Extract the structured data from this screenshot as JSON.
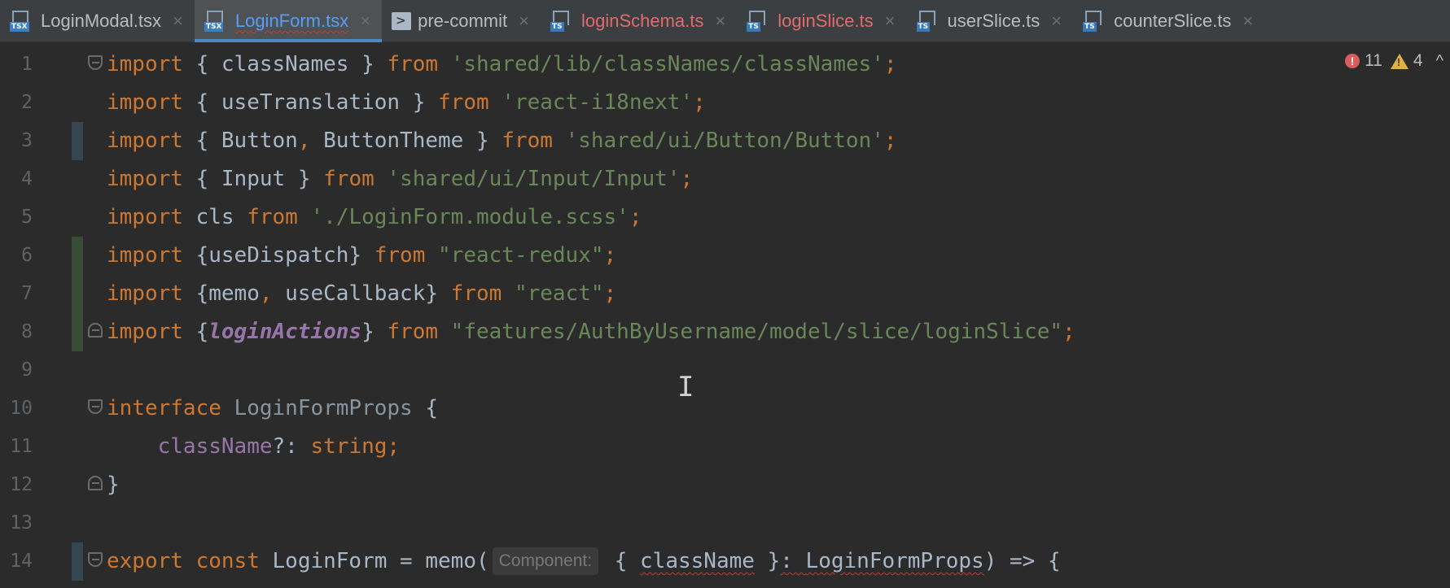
{
  "tabs": [
    {
      "label": "LoginModal.tsx",
      "icon": "tsx-file-icon",
      "badge": "TSX",
      "state": "normal"
    },
    {
      "label": "LoginForm.tsx",
      "icon": "tsx-file-icon",
      "badge": "TSX",
      "state": "active"
    },
    {
      "label": "pre-commit",
      "icon": "shell-script-icon",
      "badge": ">",
      "state": "normal"
    },
    {
      "label": "loginSchema.ts",
      "icon": "ts-file-icon",
      "badge": "TS",
      "state": "error"
    },
    {
      "label": "loginSlice.ts",
      "icon": "ts-file-icon",
      "badge": "TS",
      "state": "error"
    },
    {
      "label": "userSlice.ts",
      "icon": "ts-file-icon",
      "badge": "TS",
      "state": "normal"
    },
    {
      "label": "counterSlice.ts",
      "icon": "ts-file-icon",
      "badge": "TS",
      "state": "normal"
    }
  ],
  "tab_close_glyph": "×",
  "inspections": {
    "errors": "11",
    "warnings": "4",
    "error_glyph": "!",
    "warning_glyph": "!",
    "collapse_glyph": "^"
  },
  "line_numbers": [
    "1",
    "2",
    "3",
    "4",
    "5",
    "6",
    "7",
    "8",
    "9",
    "10",
    "11",
    "12",
    "13",
    "14"
  ],
  "code": {
    "l1": {
      "kw1": "import",
      "p1": " { ",
      "id1": "classNames",
      "p2": " } ",
      "kw2": "from",
      "sp": " ",
      "str": "'shared/lib/classNames/classNames'",
      "semi": ";"
    },
    "l2": {
      "kw1": "import",
      "p1": " { ",
      "id1": "useTranslation",
      "p2": " } ",
      "kw2": "from",
      "sp": " ",
      "str": "'react-i18next'",
      "semi": ";"
    },
    "l3": {
      "kw1": "import",
      "p1": " { ",
      "id1": "Button",
      "comma": ",",
      "sp0": " ",
      "id2": "ButtonTheme",
      "p2": " } ",
      "kw2": "from",
      "sp": " ",
      "str": "'shared/ui/Button/Button'",
      "semi": ";"
    },
    "l4": {
      "kw1": "import",
      "p1": " { ",
      "id1": "Input",
      "p2": " } ",
      "kw2": "from",
      "sp": " ",
      "str": "'shared/ui/Input/Input'",
      "semi": ";"
    },
    "l5": {
      "kw1": "import",
      "p1": " ",
      "id1": "cls",
      "p2": " ",
      "kw2": "from",
      "sp": " ",
      "str": "'./LoginForm.module.scss'",
      "semi": ";"
    },
    "l6": {
      "kw1": "import",
      "p1": " {",
      "id1": "useDispatch",
      "p2": "} ",
      "kw2": "from",
      "sp": " ",
      "str": "\"react-redux\"",
      "semi": ";"
    },
    "l7": {
      "kw1": "import",
      "p1": " {",
      "id1": "memo",
      "comma": ",",
      "sp0": " ",
      "id2": "useCallback",
      "p2": "} ",
      "kw2": "from",
      "sp": " ",
      "str": "\"react\"",
      "semi": ";"
    },
    "l8": {
      "kw1": "import",
      "p1": " {",
      "id1": "loginActions",
      "p2": "} ",
      "kw2": "from",
      "sp": " ",
      "str": "\"features/AuthByUsername/model/slice/loginSlice\"",
      "semi": ";"
    },
    "l10": {
      "kw1": "interface",
      "sp": " ",
      "name": "LoginFormProps",
      "brace": " {"
    },
    "l11": {
      "indent": "    ",
      "field": "className",
      "opt": "?: ",
      "type": "string",
      "semi": ";"
    },
    "l12": {
      "brace": "}"
    },
    "l14": {
      "kw1": "export",
      "sp1": " ",
      "kw2": "const",
      "sp2": " ",
      "name": "LoginForm",
      "eq": " = ",
      "fn": "memo",
      "paren": "(",
      "hint": "Component:",
      "p1": " { ",
      "param": "className",
      "p2": " }",
      "colon": ": ",
      "ptype": "LoginFormProps",
      "rest": ") => {"
    }
  },
  "cursor_glyph": "I"
}
